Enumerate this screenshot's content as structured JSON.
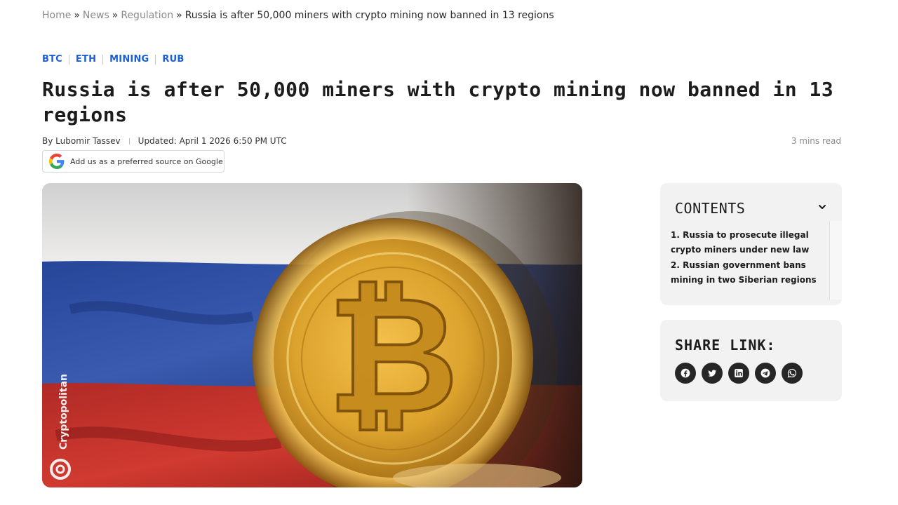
{
  "breadcrumb": {
    "home": "Home",
    "news": "News",
    "regulation": "Regulation",
    "separator": "»",
    "current": "Russia is after 50,000 miners with crypto mining now banned in 13 regions"
  },
  "tags": [
    "BTC",
    "ETH",
    "MINING",
    "RUB"
  ],
  "article": {
    "title": "Russia is after 50,000 miners with crypto mining now banned in 13 regions",
    "author": "By Lubomir Tassev",
    "updated": "Updated: April 1 2026 6:50 PM UTC",
    "read_time": "3 mins read"
  },
  "google_button": {
    "label": "Add us as a preferred source on Google"
  },
  "hero": {
    "watermark": "Cryptopolitan"
  },
  "contents": {
    "heading": "CONTENTS",
    "items": [
      "1.  Russia to prosecute illegal crypto miners under new law",
      "2.  Russian government bans mining in two Siberian regions"
    ]
  },
  "share": {
    "heading": "SHARE LINK:",
    "icons": [
      "facebook-icon",
      "twitter-icon",
      "linkedin-icon",
      "telegram-icon",
      "whatsapp-icon"
    ]
  },
  "colors": {
    "tag_blue": "#1a5fd6",
    "panel_bg": "#f2f2f2",
    "share_icon_bg": "#262626"
  }
}
